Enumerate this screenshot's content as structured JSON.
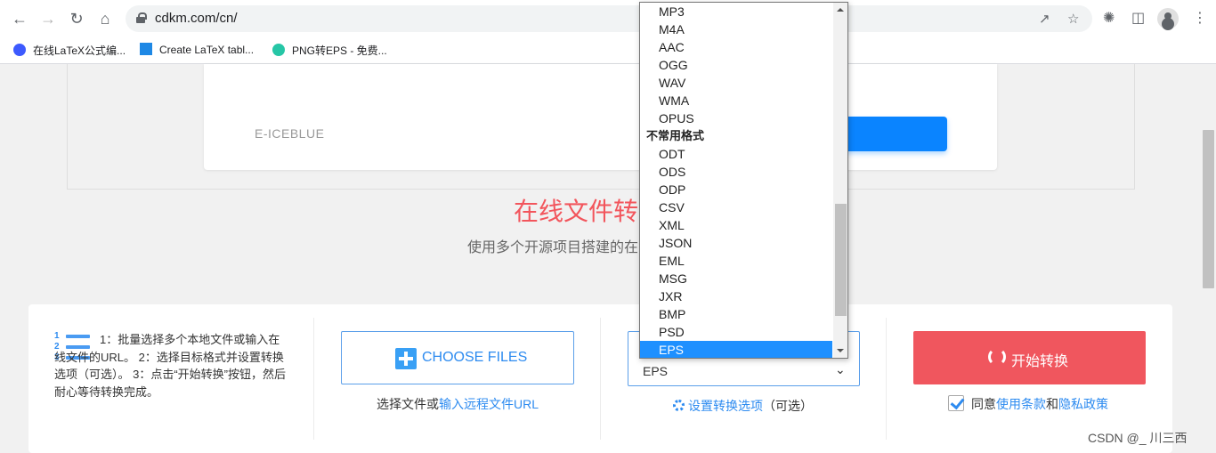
{
  "browser": {
    "url": "cdkm.com/cn/",
    "bookmarks": [
      {
        "label": "在线LaTeX公式编..."
      },
      {
        "label": "Create LaTeX tabl..."
      },
      {
        "label": "PNG转EPS - 免费..."
      }
    ]
  },
  "ad": {
    "brand": "E-ICEBLUE"
  },
  "hero": {
    "title": "在线文件转",
    "subtitle": "使用多个开源项目搭建的在"
  },
  "instructions": {
    "text": "1：批量选择多个本地文件或输入在线文件的URL。 2：选择目标格式并设置转换选项（可选）。 3：点击“开始转换”按钮，然后耐心等待转换完成。"
  },
  "upload": {
    "button_label": "CHOOSE FILES",
    "caption_prefix": "选择文件或",
    "caption_link": "输入远程文件URL"
  },
  "format": {
    "selected": "EPS",
    "options_link": "设置转换选项",
    "options_suffix": "（可选）"
  },
  "dropdown": {
    "items_top": [
      "MP3",
      "M4A",
      "AAC",
      "OGG",
      "WAV",
      "WMA",
      "OPUS"
    ],
    "group_label": "不常用格式",
    "items_bottom": [
      "ODT",
      "ODS",
      "ODP",
      "CSV",
      "XML",
      "JSON",
      "EML",
      "MSG",
      "JXR",
      "BMP",
      "PSD"
    ],
    "selected_item": "EPS"
  },
  "convert": {
    "button_label": "开始转换",
    "agree_prefix": "同意",
    "terms_link": "使用条款",
    "and": "和",
    "privacy_link": "隐私政策"
  },
  "watermark": "CSDN @_ 川三西",
  "colors": {
    "accent_blue": "#2d8bf0",
    "start_red": "#f0565e",
    "headline_red": "#f2555c",
    "selected_option": "#1e90ff"
  }
}
